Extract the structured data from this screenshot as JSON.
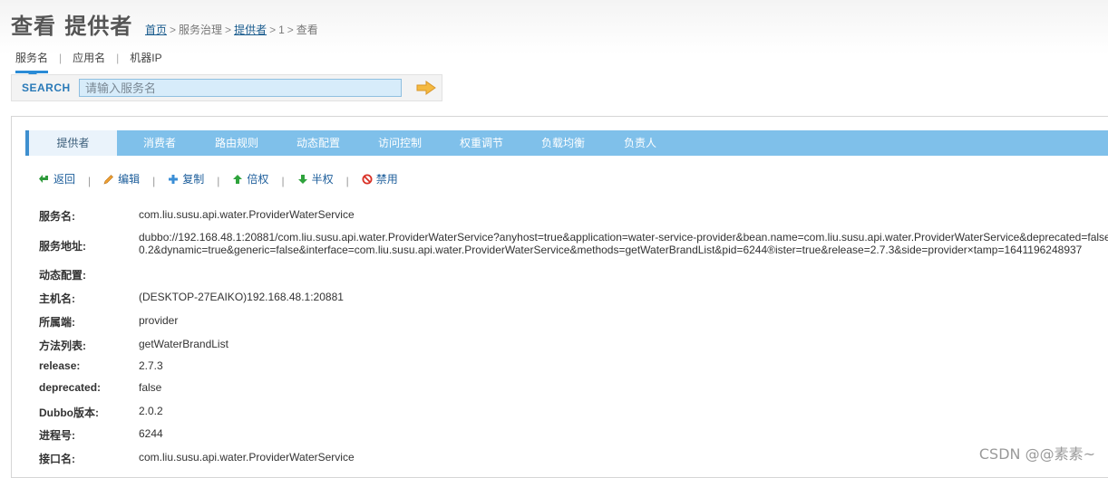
{
  "header": {
    "title": "查看 提供者",
    "breadcrumb": [
      "首页",
      "服务治理",
      "提供者",
      "1",
      "查看"
    ]
  },
  "search": {
    "tabs": [
      "服务名",
      "应用名",
      "机器IP"
    ],
    "active_tab": "服务名",
    "label": "SEARCH",
    "placeholder": "请输入服务名"
  },
  "tabs": [
    "提供者",
    "消费者",
    "路由规则",
    "动态配置",
    "访问控制",
    "权重调节",
    "负载均衡",
    "负责人"
  ],
  "active_tab": "提供者",
  "actions": [
    {
      "label": "返回",
      "icon": "back-icon"
    },
    {
      "label": "编辑",
      "icon": "pencil-icon"
    },
    {
      "label": "复制",
      "icon": "plus-icon"
    },
    {
      "label": "倍权",
      "icon": "arrow-up-icon"
    },
    {
      "label": "半权",
      "icon": "arrow-down-icon"
    },
    {
      "label": "禁用",
      "icon": "forbidden-icon"
    }
  ],
  "fields": [
    {
      "label": "服务名:",
      "value": "com.liu.susu.api.water.ProviderWaterService"
    },
    {
      "label": "服务地址:",
      "value": "dubbo://192.168.48.1:20881/com.liu.susu.api.water.ProviderWaterService?anyhost=true&application=water-service-provider&bean.name=com.liu.susu.api.water.ProviderWaterService&deprecated=false",
      "value2": "0.2&dynamic=true&generic=false&interface=com.liu.susu.api.water.ProviderWaterService&methods=getWaterBrandList&pid=6244®ister=true&release=2.7.3&side=provider×tamp=1641196248937"
    },
    {
      "label": "动态配置:",
      "value": ""
    },
    {
      "label": "主机名:",
      "value": "(DESKTOP-27EAIKO)192.168.48.1:20881"
    },
    {
      "label": "所属端:",
      "value": "provider"
    },
    {
      "label": "方法列表:",
      "value": "getWaterBrandList"
    },
    {
      "label": "release:",
      "value": "2.7.3"
    },
    {
      "label": "deprecated:",
      "value": "false"
    },
    {
      "label": "Dubbo版本:",
      "value": "2.0.2"
    },
    {
      "label": "进程号:",
      "value": "6244"
    },
    {
      "label": "接口名:",
      "value": "com.liu.susu.api.water.ProviderWaterService"
    }
  ],
  "watermark": "CSDN @@素素~",
  "colors": {
    "tab_bar": "#7fc0ea",
    "link": "#1d5e9b",
    "accent": "#2a8bd6"
  }
}
